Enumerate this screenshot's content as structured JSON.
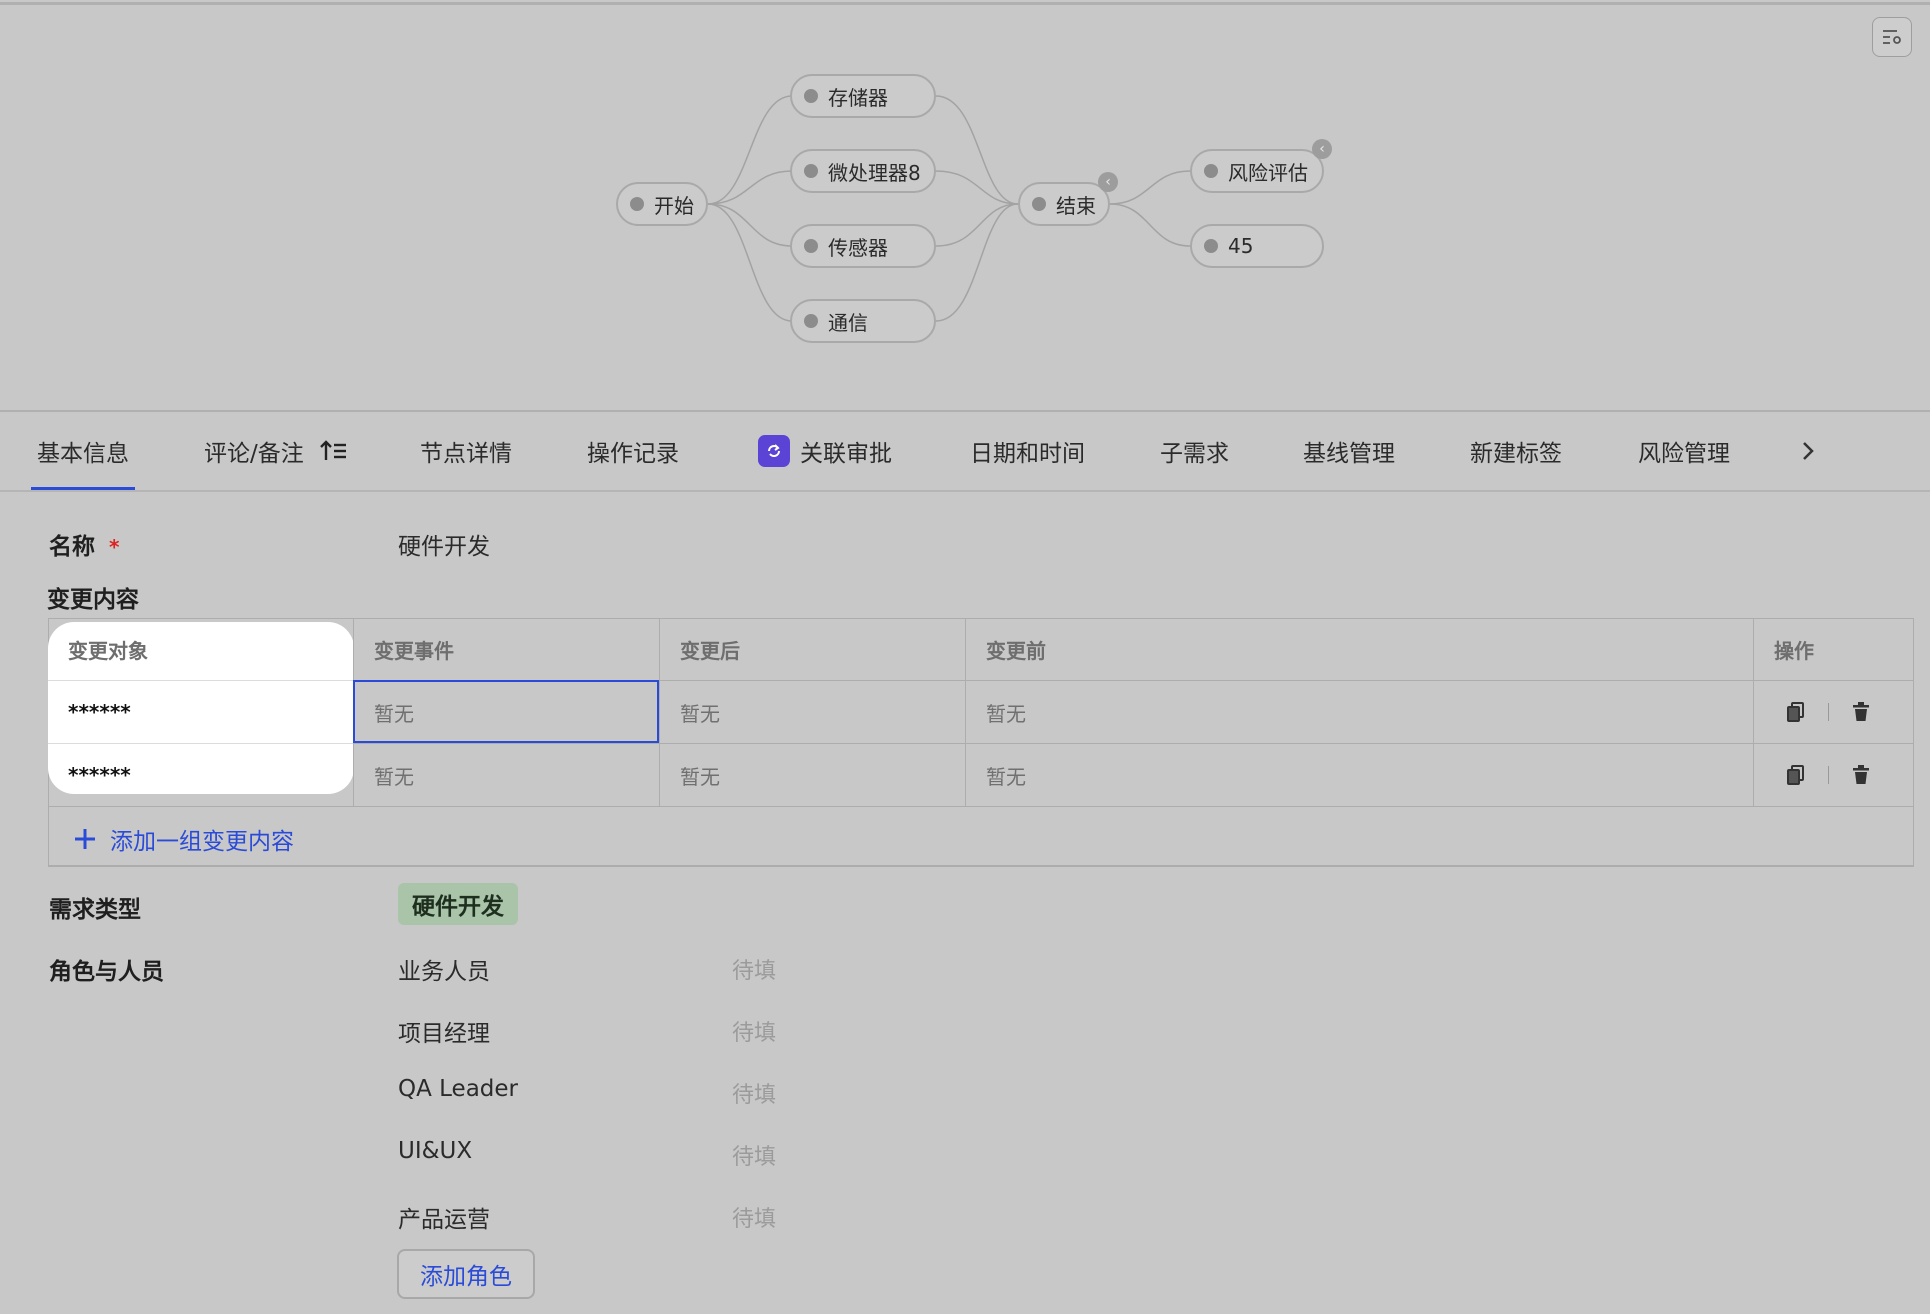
{
  "flow": {
    "nodes": {
      "start": "开始",
      "storage": "存储器",
      "microprocessor": "微处理器8",
      "sensor": "传感器",
      "comm": "通信",
      "end": "结束",
      "risk": "风险评估",
      "n45": "45"
    }
  },
  "tabs": [
    "基本信息",
    "评论/备注",
    "节点详情",
    "操作记录",
    "关联审批",
    "日期和时间",
    "子需求",
    "基线管理",
    "新建标签",
    "风险管理"
  ],
  "form": {
    "name_label": "名称",
    "required_mark": "*",
    "name_value": "硬件开发",
    "change_label": "变更内容",
    "table": {
      "headers": [
        "变更对象",
        "变更事件",
        "变更后",
        "变更前",
        "操作"
      ],
      "rows": [
        [
          "******",
          "暂无",
          "暂无",
          "暂无"
        ],
        [
          "******",
          "暂无",
          "暂无",
          "暂无"
        ]
      ]
    },
    "add_change": "添加一组变更内容",
    "type_label": "需求类型",
    "type_value": "硬件开发",
    "roles_label": "角色与人员",
    "roles": [
      {
        "name": "业务人员",
        "value": "待填"
      },
      {
        "name": "项目经理",
        "value": "待填"
      },
      {
        "name": "QA Leader",
        "value": "待填"
      },
      {
        "name": "UI&UX",
        "value": "待填"
      },
      {
        "name": "产品运营",
        "value": "待填"
      }
    ],
    "add_role": "添加角色"
  },
  "colors": {
    "accent": "#2a4bd8",
    "approval_icon": "#5b43d6",
    "tag_bg": "#a9c4a9",
    "required": "#dd2222"
  }
}
